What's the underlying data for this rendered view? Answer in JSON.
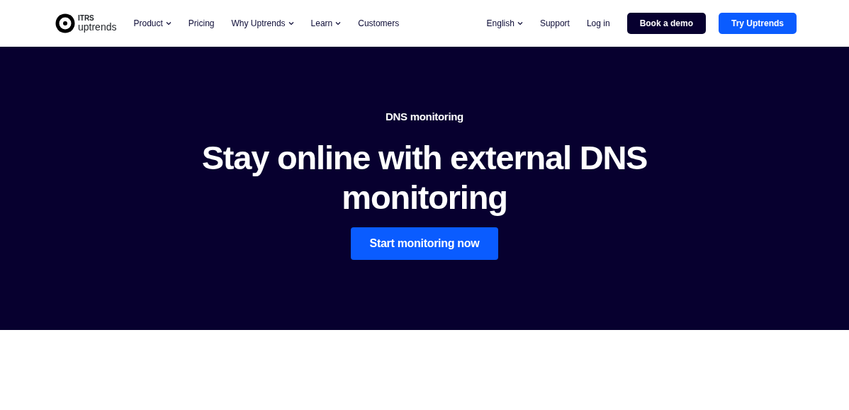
{
  "logo": {
    "line_1": "ITRS",
    "line_2": "uptrends"
  },
  "nav": [
    {
      "label": "Product",
      "has_menu": true
    },
    {
      "label": "Pricing",
      "has_menu": false
    },
    {
      "label": "Why Uptrends",
      "has_menu": true
    },
    {
      "label": "Learn",
      "has_menu": true
    },
    {
      "label": "Customers",
      "has_menu": false
    }
  ],
  "utility_nav": [
    {
      "label": "English",
      "has_menu": true
    },
    {
      "label": "Support",
      "has_menu": false
    },
    {
      "label": "Log in",
      "has_menu": false
    }
  ],
  "header_buttons": [
    {
      "label": "Book a demo",
      "kind": "dark"
    },
    {
      "label": "Try Uptrends",
      "kind": "primary"
    }
  ],
  "hero": {
    "eyebrow": "DNS monitoring",
    "title": "Stay online with external DNS monitoring",
    "button": "Start monitoring now"
  }
}
